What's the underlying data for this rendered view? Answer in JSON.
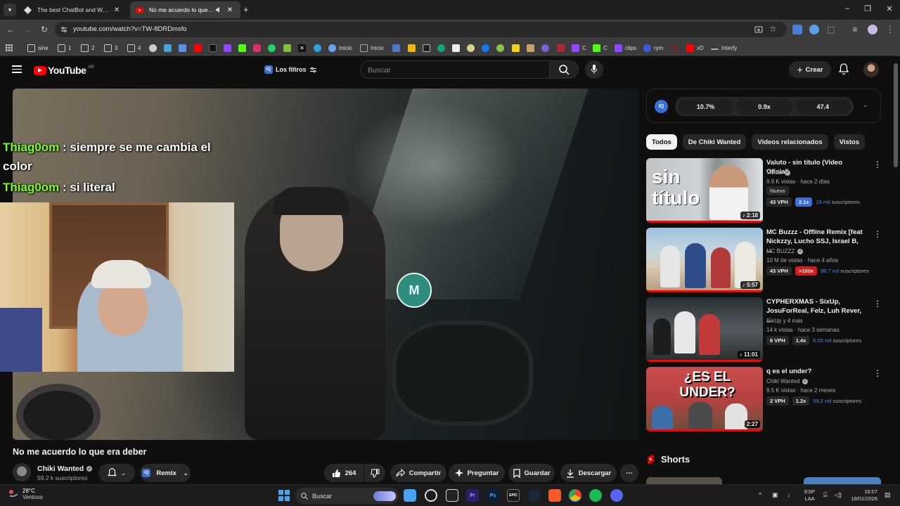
{
  "browser": {
    "tabs": [
      {
        "title": "The best ChatBot and Widgets",
        "active": false
      },
      {
        "title": "No me acuerdo lo que era d",
        "active": true
      }
    ],
    "url": "youtube.com/watch?v=TW-8DRDmsfo",
    "bookmarks": [
      "sine",
      "1",
      "2",
      "3",
      "4",
      "Inicio",
      "Inicio",
      "C",
      "C",
      "clips",
      "rym",
      "xD",
      "Interfy"
    ]
  },
  "youtube": {
    "region": "AR",
    "logo_text": "YouTube",
    "filters_label": "Los filtros",
    "search_placeholder": "Buscar",
    "create_label": "Crear"
  },
  "chat_overlay": [
    {
      "user": "Thiag0om",
      "message": "siempre se me cambia el color"
    },
    {
      "user": "Thiag0om",
      "message": "si literal"
    }
  ],
  "video": {
    "overlay_logo": "M",
    "title": "No me acuerdo lo que era deber",
    "channel": "Chiki Wanted",
    "subscribers": "59.2 k suscriptores",
    "remix_label": "Remix",
    "likes": "264",
    "share_label": "Compartir",
    "ask_label": "Preguntar",
    "save_label": "Guardar",
    "download_label": "Descargar"
  },
  "iq_panel": {
    "logo": "IQ",
    "stats": [
      "10.7%",
      "0.9x",
      "47.4"
    ]
  },
  "chips": [
    "Todos",
    "De Chiki Wanted",
    "Videos relacionados",
    "Vistos"
  ],
  "recommendations": [
    {
      "title": "Valuto - sin título (Video Oficial)",
      "channel": "Valuto",
      "meta": "9.9 K vistas · hace 2 días",
      "badge_new": "Nuevo",
      "vph": "43 VPH",
      "mult": "2.1x",
      "subs_num": "19 mil",
      "subs_label": "suscriptores",
      "duration": "2:18",
      "thumb_text": "sin título"
    },
    {
      "title": "MC Buzzz - Offline Remix [feat Nickzzy, Lucho SSJ, Israel B, ...",
      "channel": "MC BUZZZ",
      "meta": "10 M de vistas · hace 4 años",
      "vph": "43 VPH",
      "mult": ">100x",
      "subs_num": "98.7 mil",
      "subs_label": "suscriptores",
      "duration": "5:57"
    },
    {
      "title": "CYPHERXMAS - SixUp, JosuForReal, Felz, Luh Rever, ...",
      "channel": "SixUp y 4 más",
      "meta": "14 k vistas · hace 3 semanas",
      "vph": "6 VPH",
      "mult": "1.4x",
      "subs_num": "6.05 mil",
      "subs_label": "suscriptores",
      "duration": "11:01"
    },
    {
      "title": "q es el under?",
      "channel": "Chiki Wanted",
      "meta": "9.5 K vistas · hace 2 meses",
      "vph": "2 VPH",
      "mult": "1.2x",
      "subs_num": "59.2 mil",
      "subs_label": "suscriptores",
      "duration": "2:27",
      "thumb_text": "¿ES EL UNDER?"
    }
  ],
  "shorts_label": "Shorts",
  "taskbar": {
    "temperature": "28°C",
    "weather": "Ventoso",
    "search": "Buscar",
    "lang_top": "ESP",
    "lang_bottom": "LAA",
    "time": "16:07",
    "date": "18/01/2026"
  },
  "colors": {
    "accent_red": "#ff0000",
    "iq_blue": "#3b6ed9",
    "chat_user": "#7cfc2b",
    "subs_blue": "#4c8ce4"
  }
}
